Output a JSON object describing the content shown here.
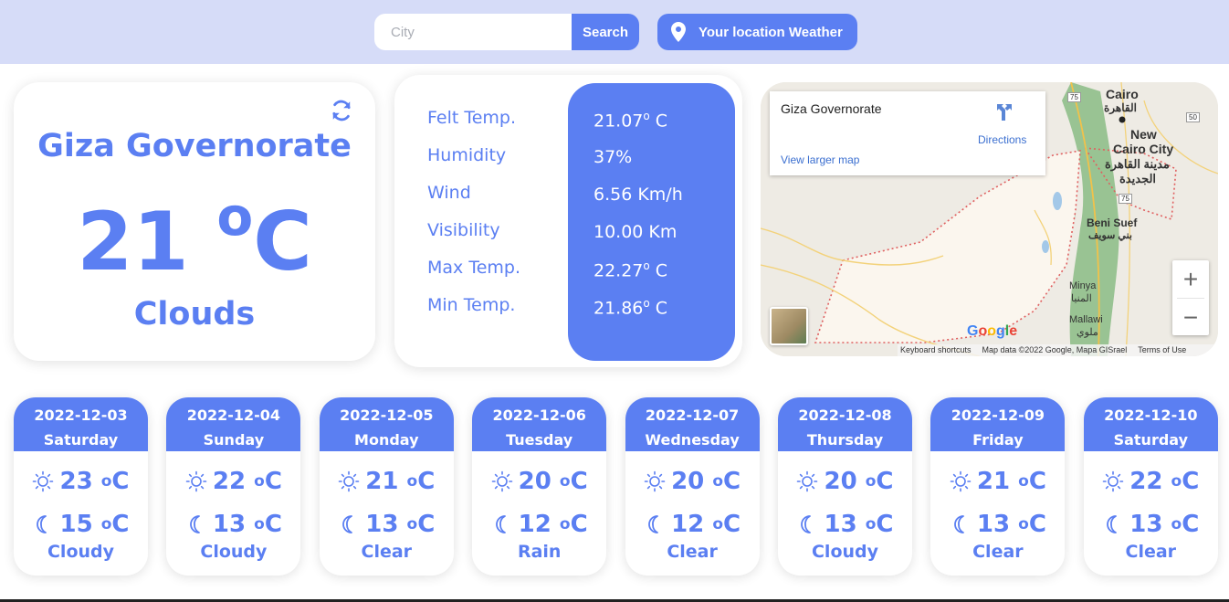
{
  "search": {
    "placeholder": "City",
    "button_label": "Search"
  },
  "location_button_label": "Your location Weather",
  "current": {
    "city": "Giza Governorate",
    "temp": "21",
    "unit_sup": "o",
    "unit": "C",
    "condition": "Clouds"
  },
  "details": {
    "labels": [
      "Felt Temp.",
      "Humidity",
      "Wind",
      "Visibility",
      "Max Temp.",
      "Min Temp."
    ],
    "felt": "21.07",
    "humidity": "37%",
    "wind": "6.56 Km/h",
    "visibility": "10.00 Km",
    "max": "22.27",
    "min": "21.86",
    "deg": "o",
    "unit": " C"
  },
  "map": {
    "place": "Giza Governorate",
    "directions": "Directions",
    "larger": "View larger map",
    "google": "Google",
    "footer": [
      "Keyboard shortcuts",
      "Map data ©2022 Google, Mapa GISrael",
      "Terms of Use"
    ],
    "labels": [
      "Cairo",
      "القاهرة",
      "New",
      "Cairo City",
      "مدينة القاهرة",
      "الجديدة",
      "Beni Suef",
      "بني سويف",
      "Minya",
      "المنيا",
      "Mallawi",
      "ملوي",
      "75",
      "50",
      "75"
    ],
    "zoom_in": "+",
    "zoom_out": "−"
  },
  "forecast": [
    {
      "date": "2022-12-03",
      "day": "Saturday",
      "high": "23",
      "low": "15",
      "cond": "Cloudy"
    },
    {
      "date": "2022-12-04",
      "day": "Sunday",
      "high": "22",
      "low": "13",
      "cond": "Cloudy"
    },
    {
      "date": "2022-12-05",
      "day": "Monday",
      "high": "21",
      "low": "13",
      "cond": "Clear"
    },
    {
      "date": "2022-12-06",
      "day": "Tuesday",
      "high": "20",
      "low": "12",
      "cond": "Rain"
    },
    {
      "date": "2022-12-07",
      "day": "Wednesday",
      "high": "20",
      "low": "12",
      "cond": "Clear"
    },
    {
      "date": "2022-12-08",
      "day": "Thursday",
      "high": "20",
      "low": "13",
      "cond": "Cloudy"
    },
    {
      "date": "2022-12-09",
      "day": "Friday",
      "high": "21",
      "low": "13",
      "cond": "Clear"
    },
    {
      "date": "2022-12-10",
      "day": "Saturday",
      "high": "22",
      "low": "13",
      "cond": "Clear"
    }
  ],
  "forecast_unit_sup": "o",
  "forecast_unit": "C",
  "colors": {
    "accent": "#5b7ff2",
    "topbar": "#d6dcf8"
  }
}
